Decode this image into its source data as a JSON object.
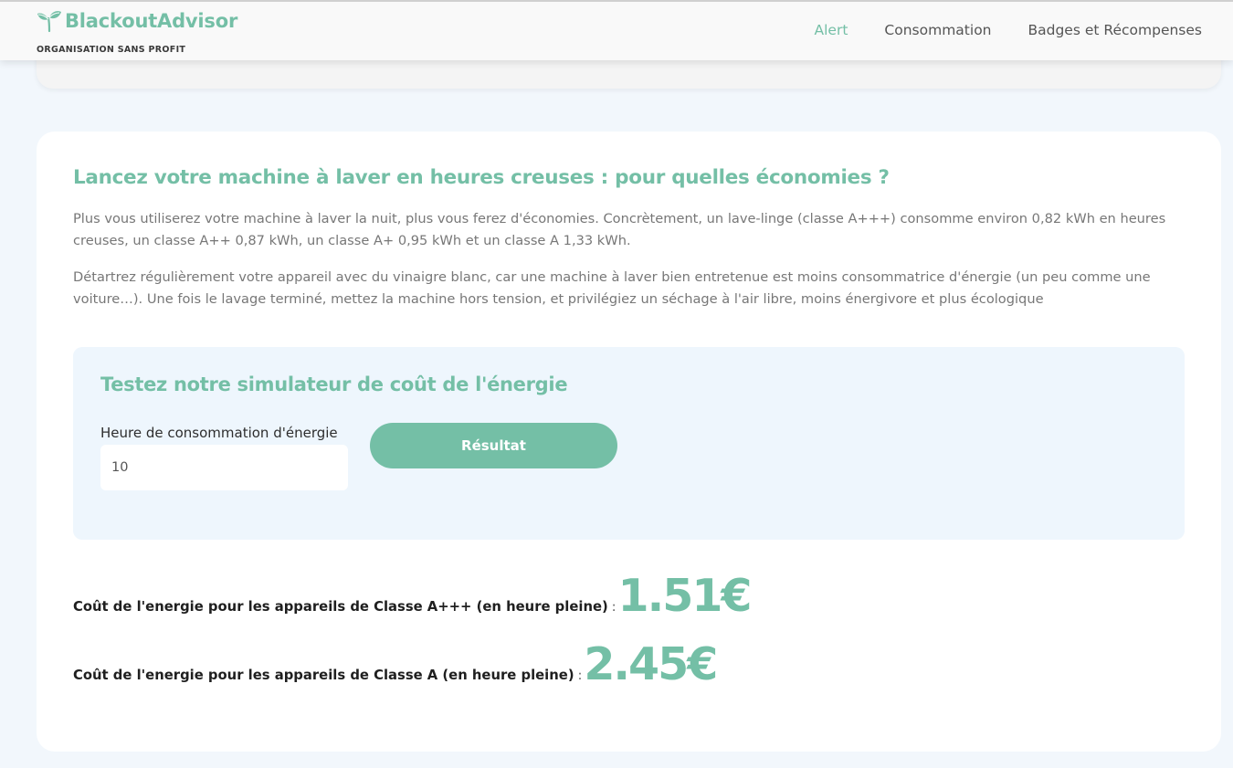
{
  "brand": {
    "name": "BlackoutAdvisor",
    "subtitle": "ORGANISATION SANS PROFIT",
    "color": "#74bfa6"
  },
  "nav": {
    "items": [
      {
        "label": "Alert",
        "active": true
      },
      {
        "label": "Consommation",
        "active": false
      },
      {
        "label": "Badges et Récompenses",
        "active": false
      }
    ]
  },
  "article": {
    "title": "Lancez votre machine à laver en heures creuses : pour quelles économies ?",
    "paragraph_1": "Plus vous utiliserez votre machine à laver la nuit, plus vous ferez d'économies. Concrètement, un lave-linge (classe A+++) consomme environ 0,82 kWh en heures creuses, un classe A++ 0,87 kWh, un classe A+ 0,95 kWh et un classe A 1,33 kWh.",
    "paragraph_2": "Détartrez régulièrement votre appareil avec du vinaigre blanc, car une machine à laver bien entretenue est moins consommatrice d'énergie (un peu comme une voiture…). Une fois le lavage terminé, mettez la machine hors tension, et privilégiez un séchage à l'air libre, moins énergivore et plus écologique"
  },
  "simulator": {
    "title": "Testez notre simulateur de coût de l'énergie",
    "input_label": "Heure de consommation d'énergie",
    "input_value": "10",
    "button_label": "Résultat"
  },
  "results": [
    {
      "label": "Coût de l'energie pour les appareils de Classe A+++ (en heure pleine)",
      "separator": ":",
      "value": "1.51€"
    },
    {
      "label": "Coût de l'energie pour les appareils de Classe A (en heure pleine)",
      "separator": ":",
      "value": "2.45€"
    }
  ]
}
